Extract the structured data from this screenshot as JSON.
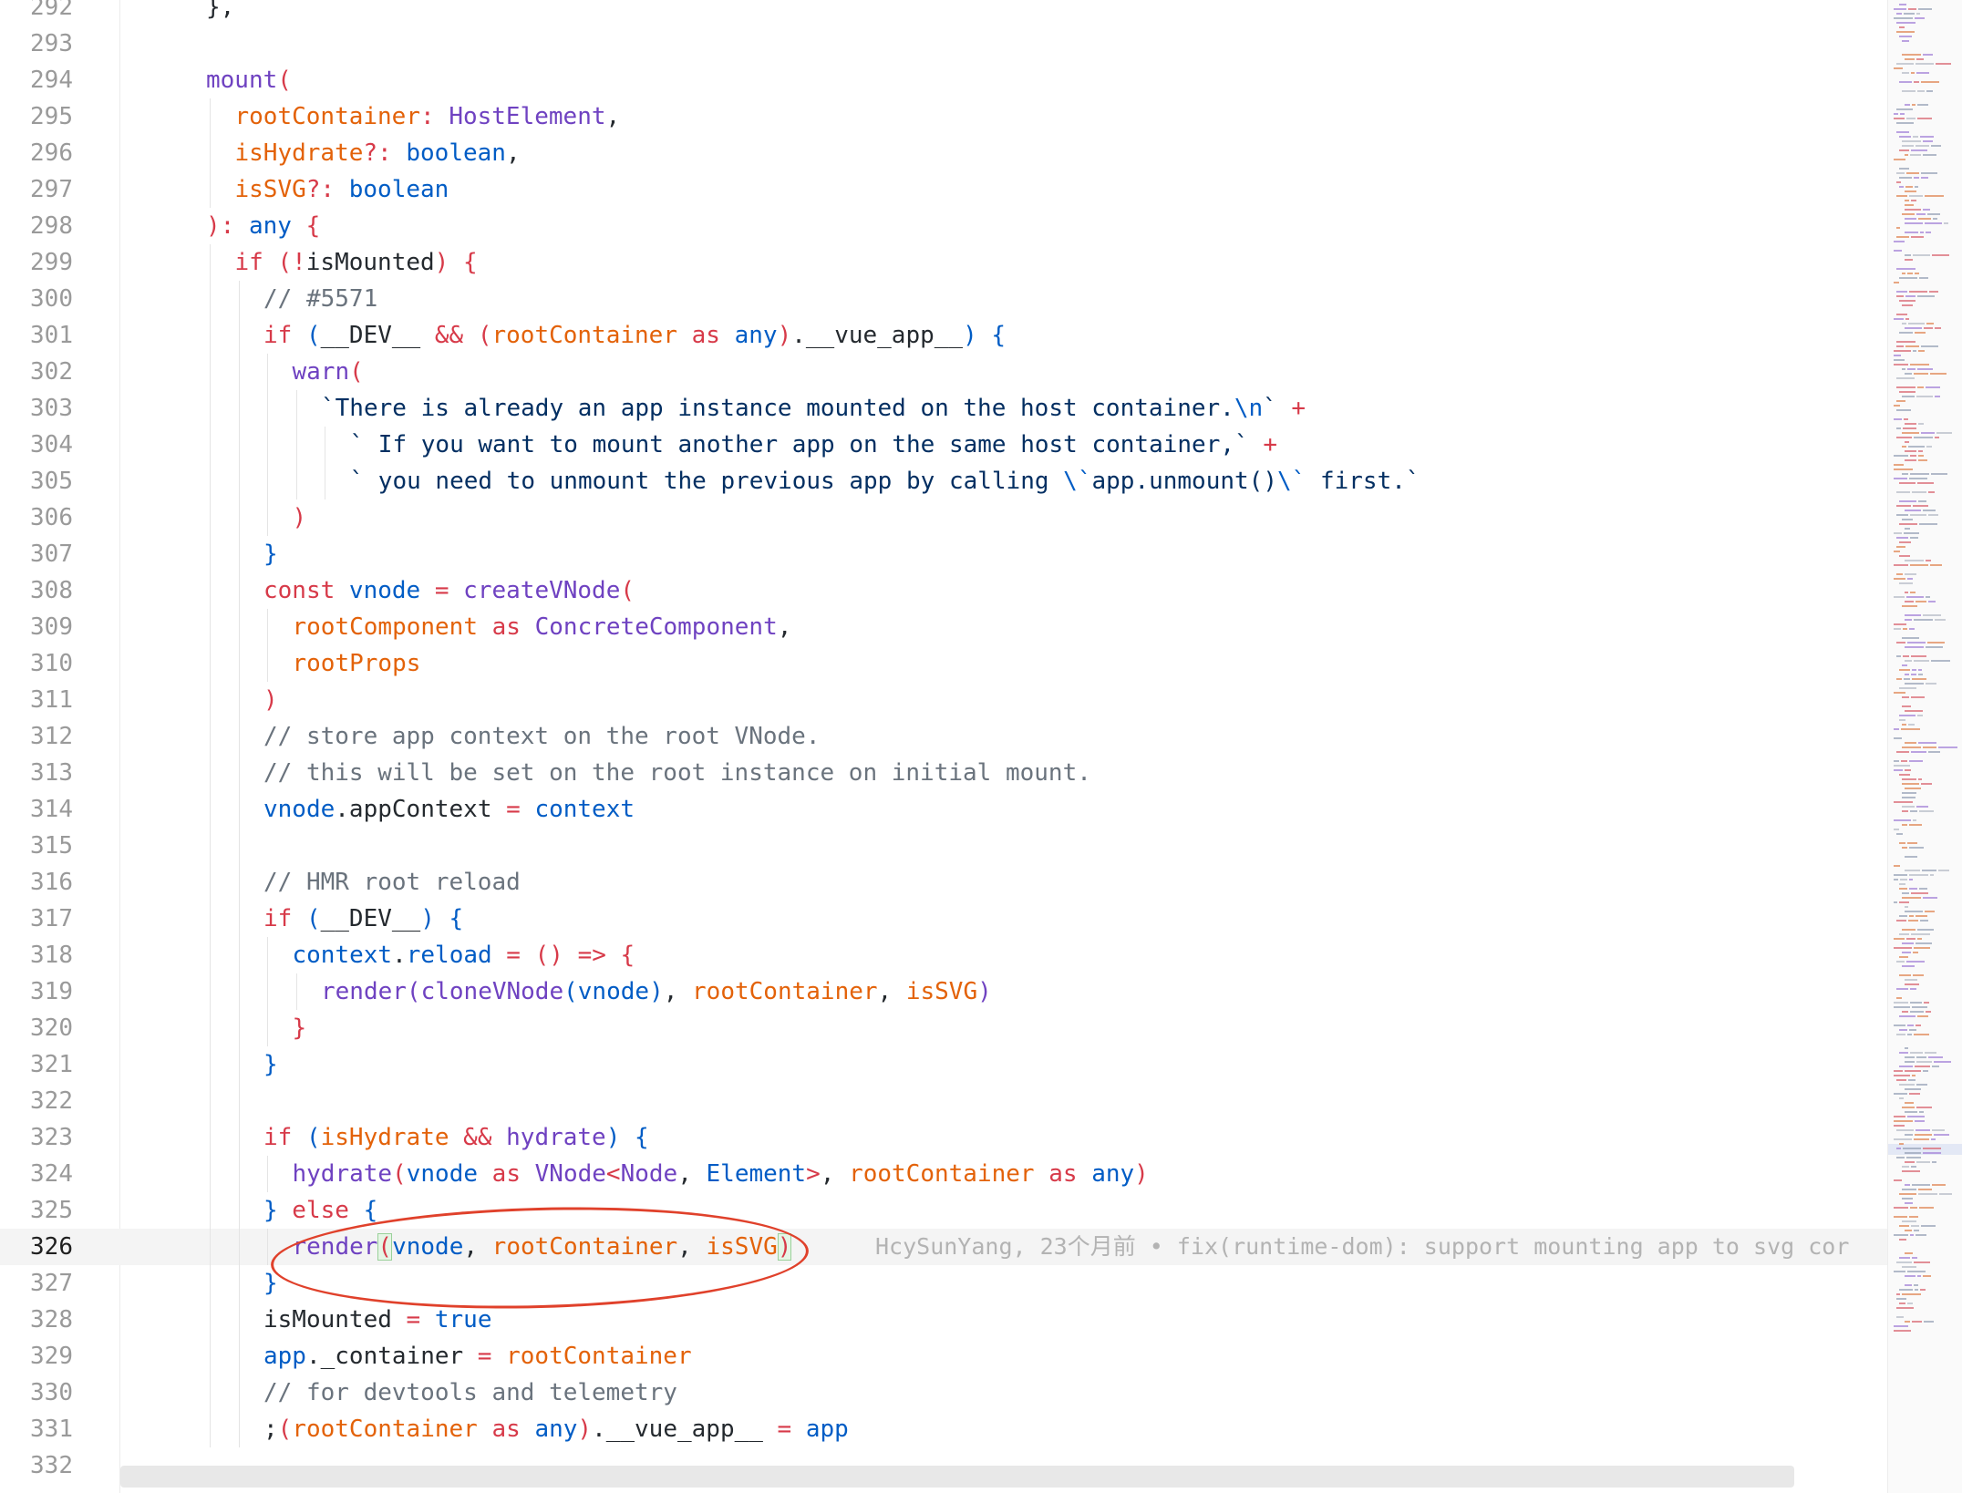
{
  "editor": {
    "lines": [
      {
        "num": "292",
        "indent": 0,
        "tokens": [
          {
            "t": "},",
            "c": "pn"
          }
        ]
      },
      {
        "num": "293",
        "indent": 0,
        "tokens": []
      },
      {
        "num": "294",
        "indent": 0,
        "tokens": [
          {
            "t": "mount",
            "c": "fn"
          },
          {
            "t": "(",
            "c": "kw"
          }
        ]
      },
      {
        "num": "295",
        "indent": 1,
        "tokens": [
          {
            "t": "rootContainer",
            "c": "param"
          },
          {
            "t": ": ",
            "c": "op"
          },
          {
            "t": "HostElement",
            "c": "fn"
          },
          {
            "t": ",",
            "c": "pn"
          }
        ]
      },
      {
        "num": "296",
        "indent": 1,
        "tokens": [
          {
            "t": "isHydrate",
            "c": "param"
          },
          {
            "t": "?: ",
            "c": "op"
          },
          {
            "t": "boolean",
            "c": "ty"
          },
          {
            "t": ",",
            "c": "pn"
          }
        ]
      },
      {
        "num": "297",
        "indent": 1,
        "tokens": [
          {
            "t": "isSVG",
            "c": "param"
          },
          {
            "t": "?: ",
            "c": "op"
          },
          {
            "t": "boolean",
            "c": "ty"
          }
        ]
      },
      {
        "num": "298",
        "indent": 0,
        "tokens": [
          {
            "t": "): ",
            "c": "kw"
          },
          {
            "t": "any",
            "c": "ty"
          },
          {
            "t": " {",
            "c": "kw"
          }
        ]
      },
      {
        "num": "299",
        "indent": 1,
        "tokens": [
          {
            "t": "if",
            "c": "kw"
          },
          {
            "t": " (",
            "c": "kw"
          },
          {
            "t": "!",
            "c": "op"
          },
          {
            "t": "isMounted",
            "c": "pn"
          },
          {
            "t": ") {",
            "c": "kw"
          }
        ]
      },
      {
        "num": "300",
        "indent": 2,
        "tokens": [
          {
            "t": "// #5571",
            "c": "cm"
          }
        ]
      },
      {
        "num": "301",
        "indent": 2,
        "tokens": [
          {
            "t": "if",
            "c": "kw"
          },
          {
            "t": " (",
            "c": "ty"
          },
          {
            "t": "__DEV__",
            "c": "pn"
          },
          {
            "t": " && ",
            "c": "op"
          },
          {
            "t": "(",
            "c": "kw"
          },
          {
            "t": "rootContainer",
            "c": "param"
          },
          {
            "t": " as ",
            "c": "kw"
          },
          {
            "t": "any",
            "c": "ty"
          },
          {
            "t": ")",
            "c": "kw"
          },
          {
            "t": ".__vue_app__",
            "c": "pn"
          },
          {
            "t": ") {",
            "c": "ty"
          }
        ]
      },
      {
        "num": "302",
        "indent": 3,
        "tokens": [
          {
            "t": "warn",
            "c": "fn"
          },
          {
            "t": "(",
            "c": "kw"
          }
        ]
      },
      {
        "num": "303",
        "indent": 4,
        "tokens": [
          {
            "t": "`There is already an app instance mounted on the host container.",
            "c": "str"
          },
          {
            "t": "\\n",
            "c": "ty"
          },
          {
            "t": "`",
            "c": "str"
          },
          {
            "t": " +",
            "c": "op"
          }
        ]
      },
      {
        "num": "304",
        "indent": 5,
        "tokens": [
          {
            "t": "` If you want to mount another app on the same host container,`",
            "c": "str"
          },
          {
            "t": " +",
            "c": "op"
          }
        ]
      },
      {
        "num": "305",
        "indent": 5,
        "tokens": [
          {
            "t": "` you need to unmount the previous app by calling ",
            "c": "str"
          },
          {
            "t": "\\`",
            "c": "ty"
          },
          {
            "t": "app.unmount()",
            "c": "str"
          },
          {
            "t": "\\`",
            "c": "ty"
          },
          {
            "t": " first.`",
            "c": "str"
          }
        ]
      },
      {
        "num": "306",
        "indent": 3,
        "tokens": [
          {
            "t": ")",
            "c": "kw"
          }
        ]
      },
      {
        "num": "307",
        "indent": 2,
        "tokens": [
          {
            "t": "}",
            "c": "ty"
          }
        ]
      },
      {
        "num": "308",
        "indent": 2,
        "tokens": [
          {
            "t": "const",
            "c": "kw"
          },
          {
            "t": " vnode",
            "c": "ty"
          },
          {
            "t": " = ",
            "c": "op"
          },
          {
            "t": "createVNode",
            "c": "fn"
          },
          {
            "t": "(",
            "c": "kw"
          }
        ]
      },
      {
        "num": "309",
        "indent": 3,
        "tokens": [
          {
            "t": "rootComponent",
            "c": "param"
          },
          {
            "t": " as ",
            "c": "kw"
          },
          {
            "t": "ConcreteComponent",
            "c": "fn"
          },
          {
            "t": ",",
            "c": "pn"
          }
        ]
      },
      {
        "num": "310",
        "indent": 3,
        "tokens": [
          {
            "t": "rootProps",
            "c": "param"
          }
        ]
      },
      {
        "num": "311",
        "indent": 2,
        "tokens": [
          {
            "t": ")",
            "c": "kw"
          }
        ]
      },
      {
        "num": "312",
        "indent": 2,
        "tokens": [
          {
            "t": "// store app context on the root VNode.",
            "c": "cm"
          }
        ]
      },
      {
        "num": "313",
        "indent": 2,
        "tokens": [
          {
            "t": "// this will be set on the root instance on initial mount.",
            "c": "cm"
          }
        ]
      },
      {
        "num": "314",
        "indent": 2,
        "tokens": [
          {
            "t": "vnode",
            "c": "ty"
          },
          {
            "t": ".appContext",
            "c": "pn"
          },
          {
            "t": " = ",
            "c": "op"
          },
          {
            "t": "context",
            "c": "ty"
          }
        ]
      },
      {
        "num": "315",
        "indent": 0,
        "tokens": []
      },
      {
        "num": "316",
        "indent": 2,
        "tokens": [
          {
            "t": "// HMR root reload",
            "c": "cm"
          }
        ]
      },
      {
        "num": "317",
        "indent": 2,
        "tokens": [
          {
            "t": "if",
            "c": "kw"
          },
          {
            "t": " (",
            "c": "ty"
          },
          {
            "t": "__DEV__",
            "c": "pn"
          },
          {
            "t": ") {",
            "c": "ty"
          }
        ]
      },
      {
        "num": "318",
        "indent": 3,
        "tokens": [
          {
            "t": "context",
            "c": "ty"
          },
          {
            "t": ".",
            "c": "pn"
          },
          {
            "t": "reload",
            "c": "ty"
          },
          {
            "t": " = ",
            "c": "op"
          },
          {
            "t": "() => {",
            "c": "kw"
          }
        ]
      },
      {
        "num": "319",
        "indent": 4,
        "tokens": [
          {
            "t": "render",
            "c": "fn"
          },
          {
            "t": "(",
            "c": "fn"
          },
          {
            "t": "cloneVNode",
            "c": "fn"
          },
          {
            "t": "(",
            "c": "ty"
          },
          {
            "t": "vnode",
            "c": "ty"
          },
          {
            "t": ")",
            "c": "ty"
          },
          {
            "t": ", ",
            "c": "pn"
          },
          {
            "t": "rootContainer",
            "c": "param"
          },
          {
            "t": ", ",
            "c": "pn"
          },
          {
            "t": "isSVG",
            "c": "param"
          },
          {
            "t": ")",
            "c": "fn"
          }
        ]
      },
      {
        "num": "320",
        "indent": 3,
        "tokens": [
          {
            "t": "}",
            "c": "kw"
          }
        ]
      },
      {
        "num": "321",
        "indent": 2,
        "tokens": [
          {
            "t": "}",
            "c": "ty"
          }
        ]
      },
      {
        "num": "322",
        "indent": 0,
        "tokens": []
      },
      {
        "num": "323",
        "indent": 2,
        "tokens": [
          {
            "t": "if",
            "c": "kw"
          },
          {
            "t": " (",
            "c": "ty"
          },
          {
            "t": "isHydrate",
            "c": "param"
          },
          {
            "t": " && ",
            "c": "op"
          },
          {
            "t": "hydrate",
            "c": "fn"
          },
          {
            "t": ") {",
            "c": "ty"
          }
        ]
      },
      {
        "num": "324",
        "indent": 3,
        "tokens": [
          {
            "t": "hydrate",
            "c": "fn"
          },
          {
            "t": "(",
            "c": "kw"
          },
          {
            "t": "vnode",
            "c": "ty"
          },
          {
            "t": " as ",
            "c": "kw"
          },
          {
            "t": "VNode",
            "c": "fn"
          },
          {
            "t": "<",
            "c": "op"
          },
          {
            "t": "Node",
            "c": "fn"
          },
          {
            "t": ", ",
            "c": "pn"
          },
          {
            "t": "Element",
            "c": "ty"
          },
          {
            "t": ">",
            "c": "op"
          },
          {
            "t": ", ",
            "c": "pn"
          },
          {
            "t": "rootContainer",
            "c": "param"
          },
          {
            "t": " as ",
            "c": "kw"
          },
          {
            "t": "any",
            "c": "ty"
          },
          {
            "t": ")",
            "c": "kw"
          }
        ]
      },
      {
        "num": "325",
        "indent": 2,
        "tokens": [
          {
            "t": "}",
            "c": "ty"
          },
          {
            "t": " else ",
            "c": "kw"
          },
          {
            "t": "{",
            "c": "ty"
          }
        ]
      },
      {
        "num": "326",
        "indent": 3,
        "current": true,
        "tokens": [
          {
            "t": "render",
            "c": "fn"
          },
          {
            "t": "(",
            "c": "kw",
            "hl": true
          },
          {
            "t": "vnode",
            "c": "ty"
          },
          {
            "t": ", ",
            "c": "pn"
          },
          {
            "t": "rootContainer",
            "c": "param"
          },
          {
            "t": ", ",
            "c": "pn"
          },
          {
            "t": "isSVG",
            "c": "param"
          },
          {
            "t": ")",
            "c": "kw",
            "hl": true
          }
        ]
      },
      {
        "num": "327",
        "indent": 2,
        "tokens": [
          {
            "t": "}",
            "c": "ty"
          }
        ]
      },
      {
        "num": "328",
        "indent": 2,
        "tokens": [
          {
            "t": "isMounted",
            "c": "pn"
          },
          {
            "t": " = ",
            "c": "op"
          },
          {
            "t": "true",
            "c": "ty"
          }
        ]
      },
      {
        "num": "329",
        "indent": 2,
        "tokens": [
          {
            "t": "app",
            "c": "ty"
          },
          {
            "t": "._container",
            "c": "pn"
          },
          {
            "t": " = ",
            "c": "op"
          },
          {
            "t": "rootContainer",
            "c": "param"
          }
        ]
      },
      {
        "num": "330",
        "indent": 2,
        "tokens": [
          {
            "t": "// for devtools and telemetry",
            "c": "cm"
          }
        ]
      },
      {
        "num": "331",
        "indent": 2,
        "tokens": [
          {
            "t": ";",
            "c": "pn"
          },
          {
            "t": "(",
            "c": "kw"
          },
          {
            "t": "rootContainer",
            "c": "param"
          },
          {
            "t": " as ",
            "c": "kw"
          },
          {
            "t": "any",
            "c": "ty"
          },
          {
            "t": ")",
            "c": "kw"
          },
          {
            "t": ".__vue_app__",
            "c": "pn"
          },
          {
            "t": " = ",
            "c": "op"
          },
          {
            "t": "app",
            "c": "ty"
          }
        ]
      },
      {
        "num": "332",
        "indent": 0,
        "tokens": []
      }
    ],
    "blame": {
      "line": "326",
      "text": "HcySunYang, 23个月前 • fix(runtime-dom): support mounting app to svg cor"
    }
  },
  "colors": {
    "keyword": "#d73a49",
    "function": "#6f42c1",
    "type": "#005cc5",
    "parameter": "#e36209",
    "string": "#032f62",
    "comment": "#6a737d",
    "annotation": "#e0412b"
  }
}
